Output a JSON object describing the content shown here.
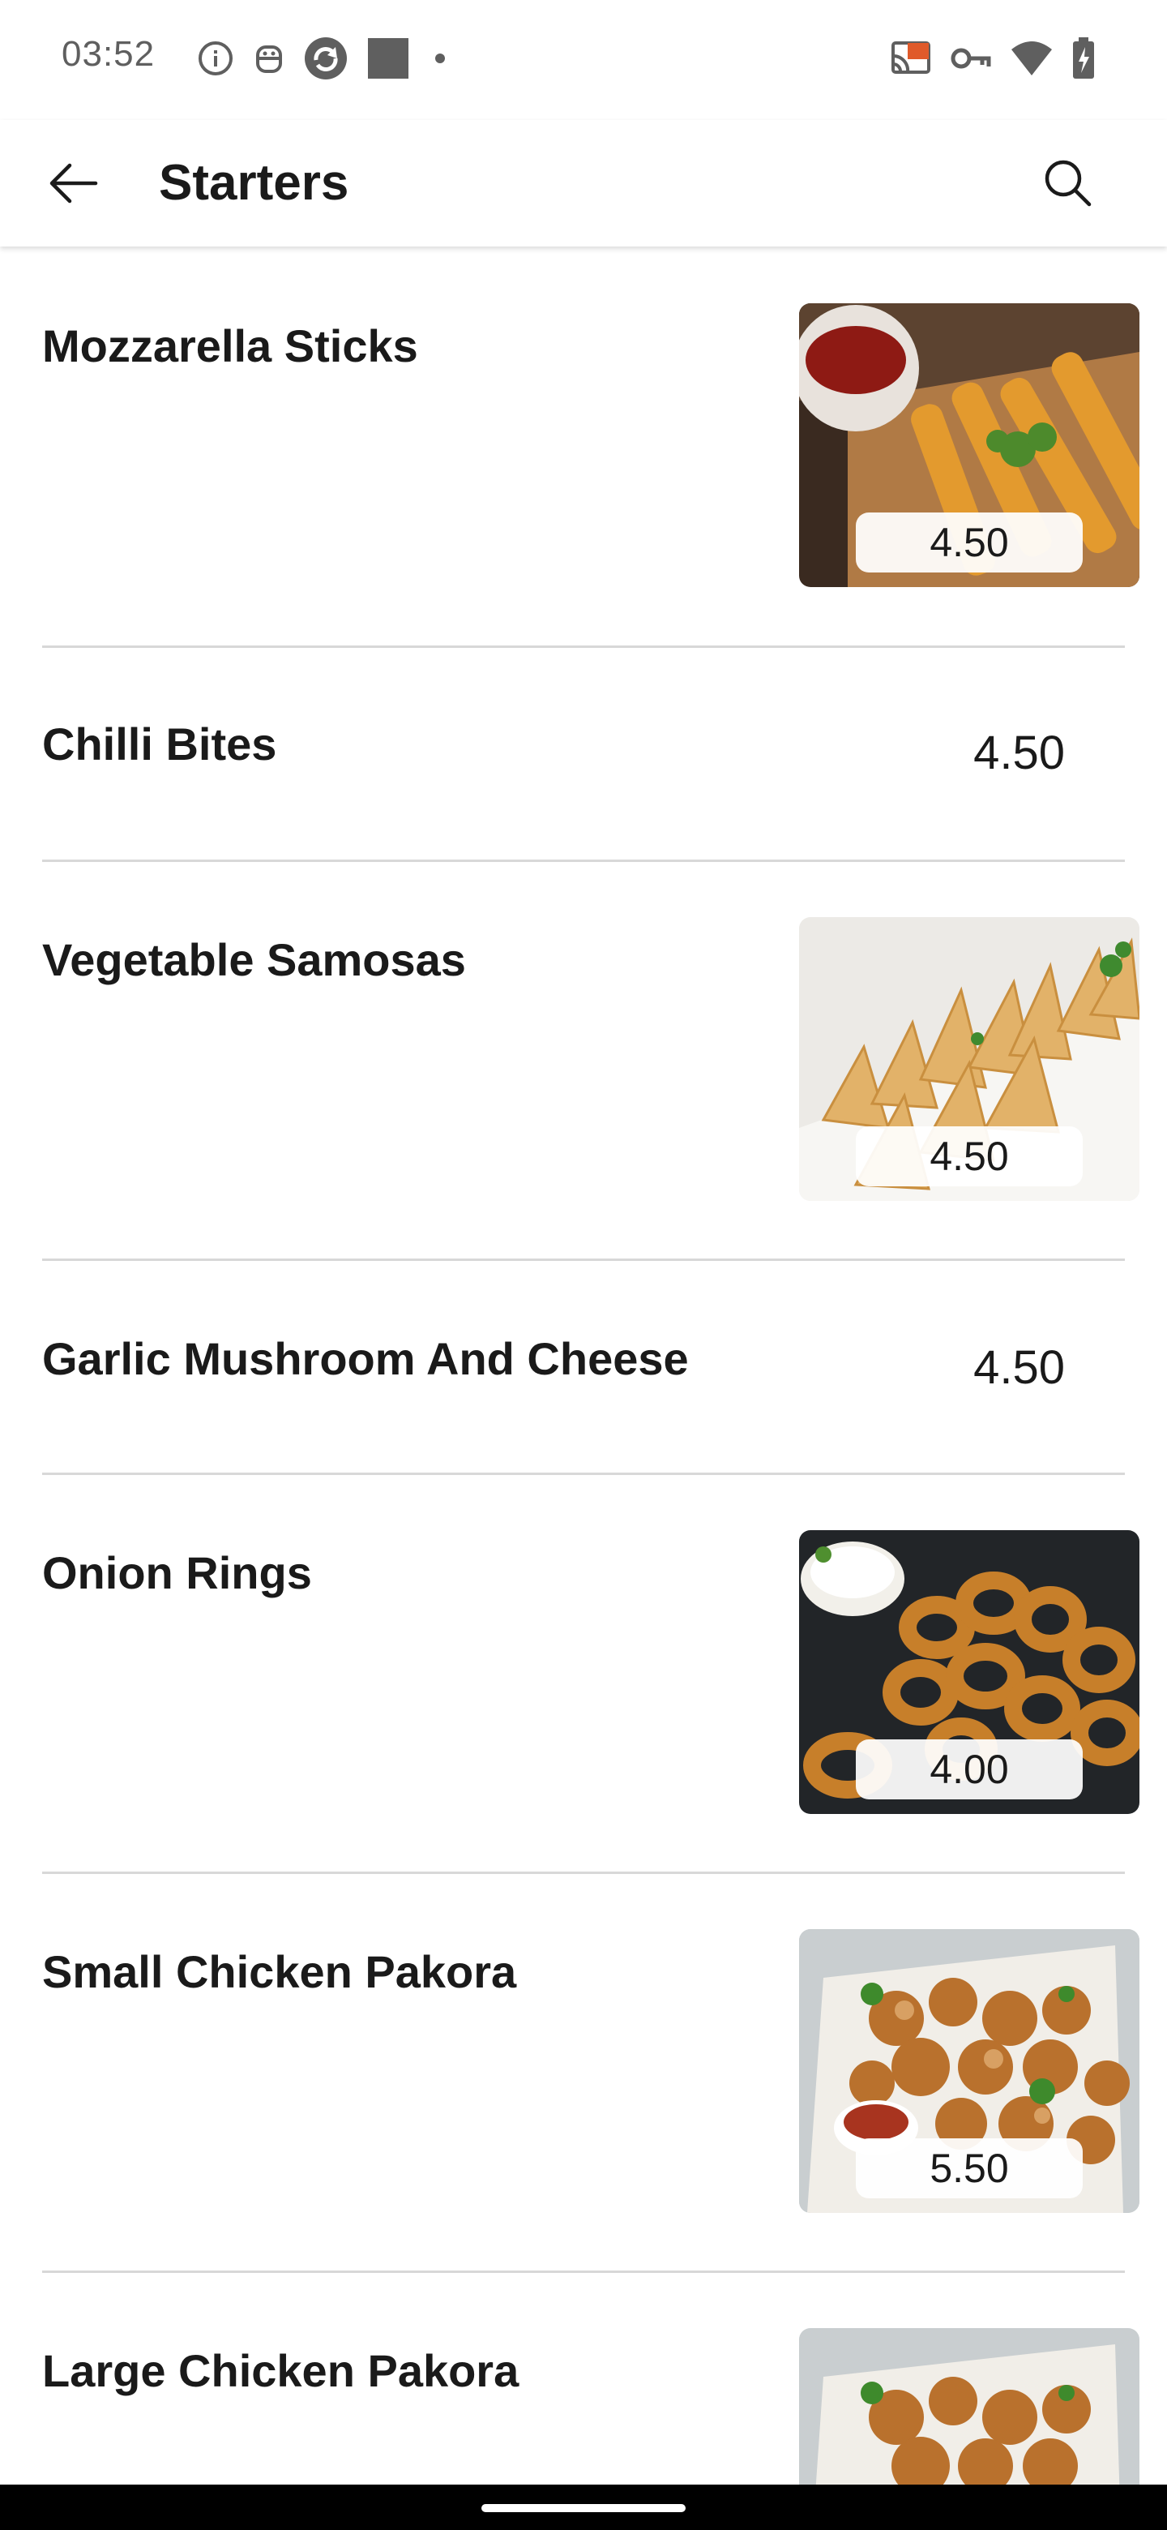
{
  "status_bar": {
    "time": "03:52",
    "left_icons": [
      "info-icon",
      "robot-icon",
      "sync-icon",
      "square-icon",
      "dot-icon"
    ],
    "right_icons": [
      "cast-icon",
      "vpn-key-icon",
      "wifi-icon",
      "battery-charging-icon"
    ]
  },
  "app_bar": {
    "title": "Starters",
    "back_icon": "arrow-back-icon",
    "search_icon": "search-icon"
  },
  "menu_items": [
    {
      "name": "Mozzarella Sticks",
      "price": "4.50",
      "has_image": true,
      "image": "mozzarella-sticks-photo"
    },
    {
      "name": "Chilli Bites",
      "price": "4.50",
      "has_image": false
    },
    {
      "name": "Vegetable Samosas",
      "price": "4.50",
      "has_image": true,
      "image": "vegetable-samosas-photo"
    },
    {
      "name": "Garlic Mushroom And Cheese",
      "price": "4.50",
      "has_image": false
    },
    {
      "name": "Onion Rings",
      "price": "4.00",
      "has_image": true,
      "image": "onion-rings-photo"
    },
    {
      "name": "Small Chicken Pakora",
      "price": "5.50",
      "has_image": true,
      "image": "chicken-pakora-photo"
    },
    {
      "name": "Large Chicken Pakora",
      "price": "",
      "has_image": true,
      "image": "chicken-pakora-photo"
    }
  ],
  "colors": {
    "text": "#1a1a1a",
    "divider": "#d8d8d8",
    "status_icon": "#5f5f5f"
  }
}
